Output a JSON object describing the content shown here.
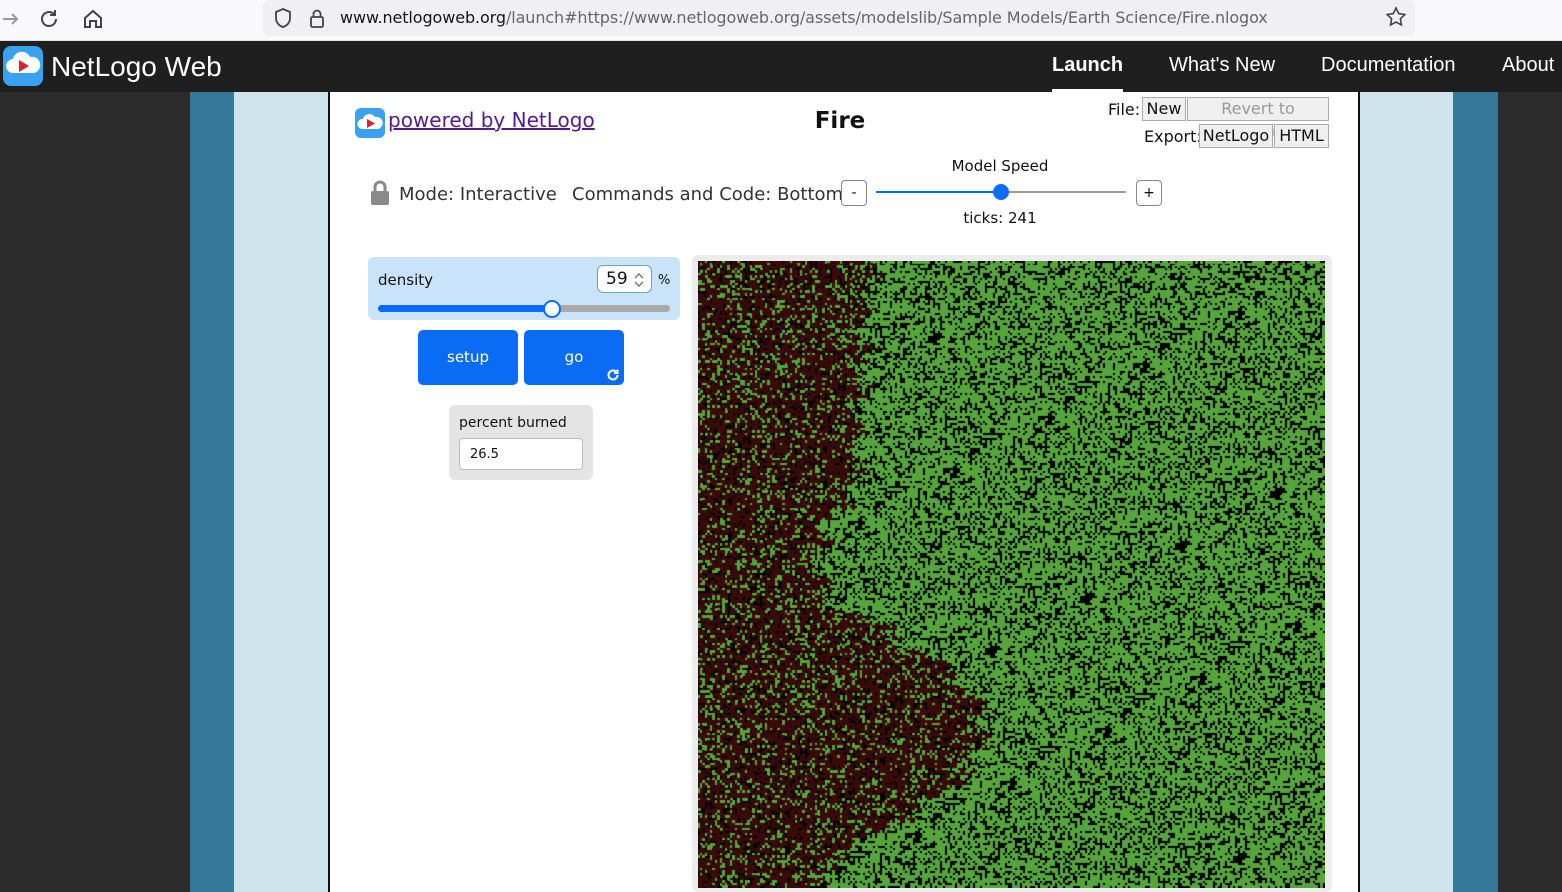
{
  "browser": {
    "url_host": "www.netlogoweb.org",
    "url_path": "/launch#https://www.netlogoweb.org/assets/modelslib/Sample Models/Earth Science/Fire.nlogox"
  },
  "navbar": {
    "brand": "NetLogo Web",
    "links": [
      "Launch",
      "What's New",
      "Documentation",
      "About"
    ]
  },
  "model": {
    "powered_by": " powered by NetLogo",
    "title": "Fire",
    "file_label": "File:",
    "file_new": "New",
    "file_revert": "Revert to Original",
    "export_label": "Export:",
    "export_netlogo": "NetLogo",
    "export_html": "HTML",
    "mode": "Mode: Interactive",
    "commands_code": "Commands and Code: Bottom",
    "speed_label": "Model Speed",
    "speed_minus": "-",
    "speed_plus": "+",
    "speed_fraction": 0.5,
    "ticks": "ticks: 241"
  },
  "widgets": {
    "density": {
      "label": "density",
      "value": "59",
      "unit": "%",
      "min": 0,
      "max": 99,
      "numeric_value": 59
    },
    "setup_label": "setup",
    "go_label": "go",
    "monitor": {
      "label": "percent burned",
      "value": "26.5"
    }
  },
  "colors": {
    "tree_green": "#55a53a",
    "burned": "#3a0a0a",
    "empty": "#000000",
    "button_blue": "#0a6cf5"
  }
}
